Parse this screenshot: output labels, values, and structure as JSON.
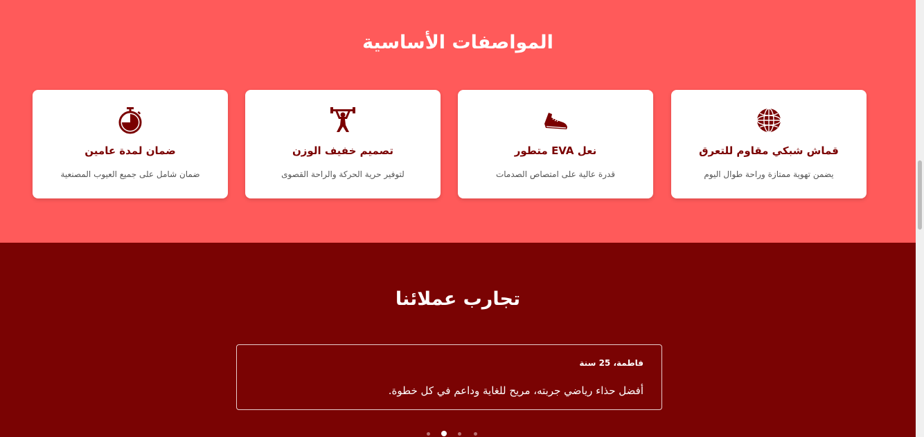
{
  "specs": {
    "title": "المواصفات الأساسية",
    "cards": [
      {
        "icon": "globe-icon",
        "title": "قماش شبكي مقاوم للتعرق",
        "desc": "يضمن تهوية ممتازة وراحة طوال اليوم"
      },
      {
        "icon": "running-shoe-icon",
        "title": "نعل EVA متطور",
        "desc": "قدرة عالية على امتصاص الصدمات"
      },
      {
        "icon": "weightlifter-icon",
        "title": "تصميم خفيف الوزن",
        "desc": "لتوفير حرية الحركة والراحة القصوى"
      },
      {
        "icon": "stopwatch-icon",
        "title": "ضمان لمدة عامين",
        "desc": "ضمان شامل على جميع العيوب المصنعية"
      }
    ]
  },
  "testimonials": {
    "title": "تجارب عملائنا",
    "current": {
      "name": "فاطمة، 25 سنة",
      "quote": "أفضل حذاء رياضي جربته، مريح للغاية وداعم في كل خطوة."
    },
    "dots_count": 4,
    "active_dot_index": 1
  },
  "colors": {
    "specs_bg": "#ff5a5a",
    "testimonials_bg": "#7a0303",
    "accent": "#7a0000"
  }
}
